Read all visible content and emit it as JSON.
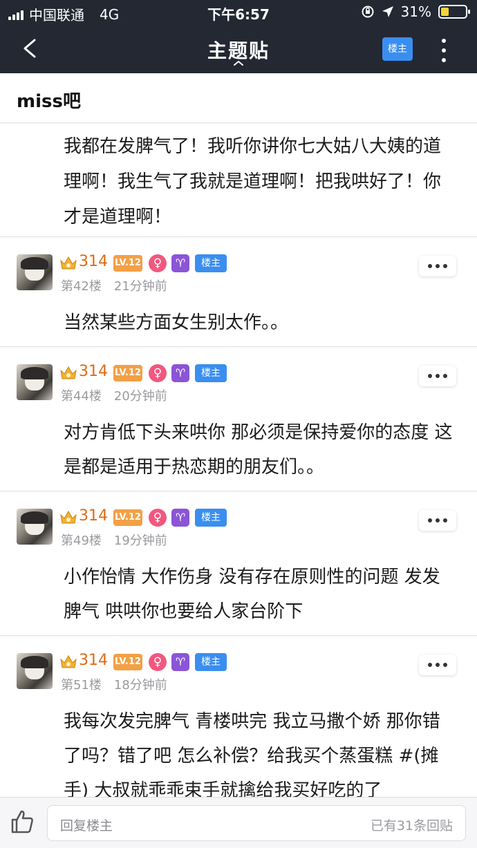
{
  "status_bar": {
    "carrier": "中国联通",
    "network": "4G",
    "time": "下午6:57",
    "battery_percent": "31%",
    "battery_level": 0.31
  },
  "nav": {
    "title": "主题贴",
    "lz_button": "楼主",
    "icons": [
      "back-icon",
      "caret-up-icon",
      "more-vertical-icon"
    ]
  },
  "forum": {
    "name": "miss吧"
  },
  "first_post": {
    "text": "我都在发脾气了！我听你讲你七大姑八大姨的道理啊！我生气了我就是道理啊！把我哄好了！你才是道理啊！"
  },
  "posts": [
    {
      "username": "314",
      "level": "LV.12",
      "gender_symbol": "♀",
      "zodiac_symbol": "♈",
      "lz_badge": "楼主",
      "floor": "第42楼",
      "time": "21分钟前",
      "text": "当然某些方面女生别太作。。"
    },
    {
      "username": "314",
      "level": "LV.12",
      "gender_symbol": "♀",
      "zodiac_symbol": "♈",
      "lz_badge": "楼主",
      "floor": "第44楼",
      "time": "20分钟前",
      "text": "对方肯低下头来哄你 那必须是保持爱你的态度 这是都是适用于热恋期的朋友们。。"
    },
    {
      "username": "314",
      "level": "LV.12",
      "gender_symbol": "♀",
      "zodiac_symbol": "♈",
      "lz_badge": "楼主",
      "floor": "第49楼",
      "time": "19分钟前",
      "text": "小作怡情 大作伤身 没有存在原则性的问题 发发脾气 哄哄你也要给人家台阶下"
    },
    {
      "username": "314",
      "level": "LV.12",
      "gender_symbol": "♀",
      "zodiac_symbol": "♈",
      "lz_badge": "楼主",
      "floor": "第51楼",
      "time": "18分钟前",
      "text": "我每次发完脾气 青楼哄完 我立马撒个娇 那你错了吗？错了吧 怎么补偿？给我买个蒸蛋糕 #(摊手) 大叔就乖乖束手就擒给我买好吃的了"
    }
  ],
  "bottom_bar": {
    "reply_placeholder": "回复楼主",
    "reply_count": "已有31条回贴"
  },
  "colors": {
    "header_bg": "#232833",
    "accent_blue": "#3a8ef0",
    "username_orange": "#e06a12",
    "level_orange": "#f3a046",
    "gender_pink": "#f2577f",
    "zodiac_purple": "#8a55d6"
  }
}
